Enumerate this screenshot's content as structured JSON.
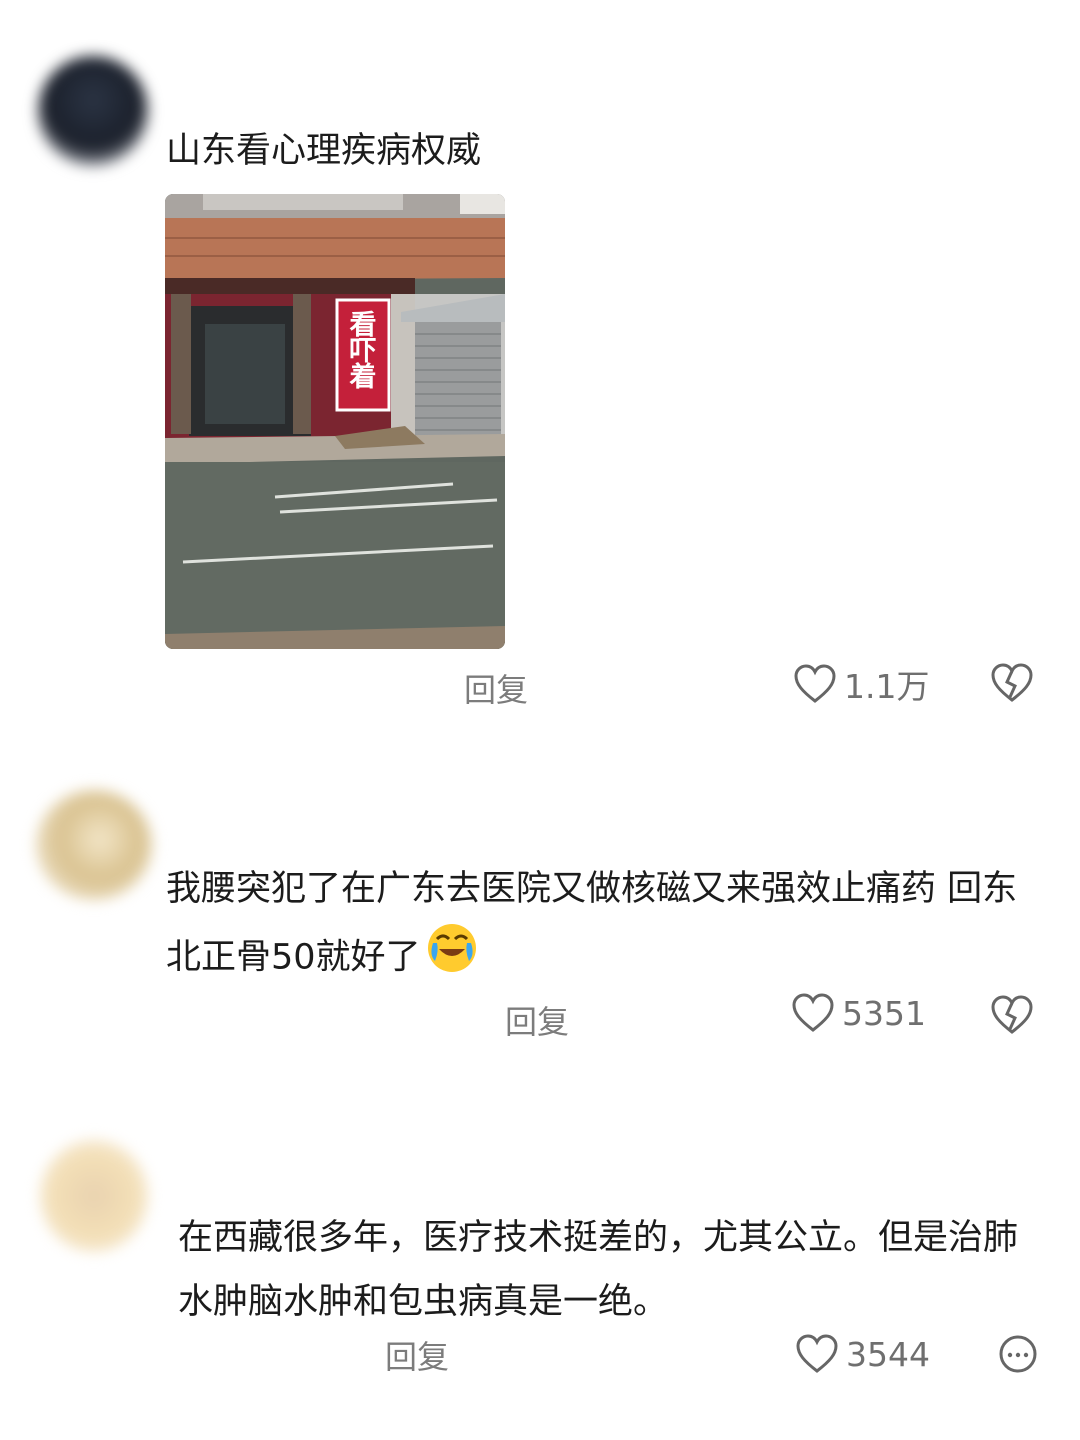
{
  "comments": [
    {
      "text": "山东看心理疾病权威",
      "reply_label": "回复",
      "like_count": "1.1万",
      "image": {
        "sign_text": "看吓着"
      }
    },
    {
      "text": "我腰突犯了在广东去医院又做核磁又来强效止痛药 回东北正骨50就好了",
      "emoji": "crying-laughing-emoji",
      "reply_label": "回复",
      "like_count": "5351"
    },
    {
      "text": "在西藏很多年，医疗技术挺差的，尤其公立。但是治肺水肿脑水肿和包虫病真是一绝。",
      "reply_label": "回复",
      "like_count": "3544"
    }
  ],
  "icons": {
    "like": "heart-outline-icon",
    "dislike": "broken-heart-icon",
    "more": "more-dots-icon"
  },
  "colors": {
    "text": "#1c1c1c",
    "meta": "#7c7c7c",
    "sign_red": "#c4203a"
  }
}
